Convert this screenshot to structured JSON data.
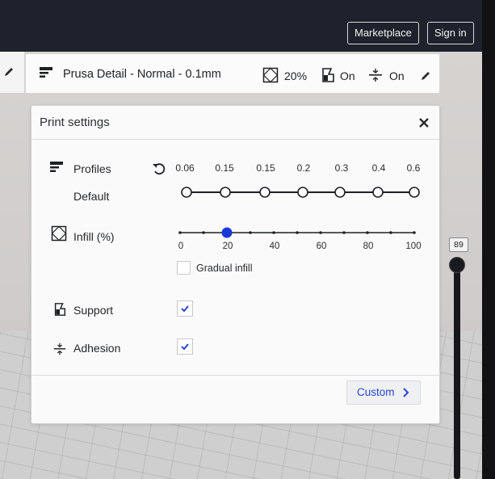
{
  "topbar": {
    "marketplace_label": "Marketplace",
    "signin_label": "Sign in"
  },
  "header": {
    "profile_name": "Prusa Detail - Normal - 0.1mm",
    "infill": "20%",
    "support": "On",
    "adhesion": "On"
  },
  "settings": {
    "title": "Print settings",
    "profiles_label": "Profiles",
    "default_label": "Default",
    "layer_heights": [
      "0.06",
      "0.15",
      "0.15",
      "0.2",
      "0.3",
      "0.4",
      "0.6"
    ],
    "infill_label": "Infill (%)",
    "infill_value": 20,
    "infill_ticks": [
      "0",
      "20",
      "40",
      "60",
      "80",
      "100"
    ],
    "gradual_label": "Gradual infill",
    "gradual_checked": false,
    "support_label": "Support",
    "support_checked": true,
    "adhesion_label": "Adhesion",
    "adhesion_checked": true,
    "custom_label": "Custom"
  },
  "layer_slider": {
    "value": "89"
  },
  "colors": {
    "accent": "#1a39d6",
    "topbar": "#1f222c",
    "custom_text": "#2b47c9"
  },
  "icons": {
    "edit": "pencil-icon",
    "close": "close-icon",
    "reset": "reset-icon",
    "chevron": "chevron-right-icon"
  }
}
